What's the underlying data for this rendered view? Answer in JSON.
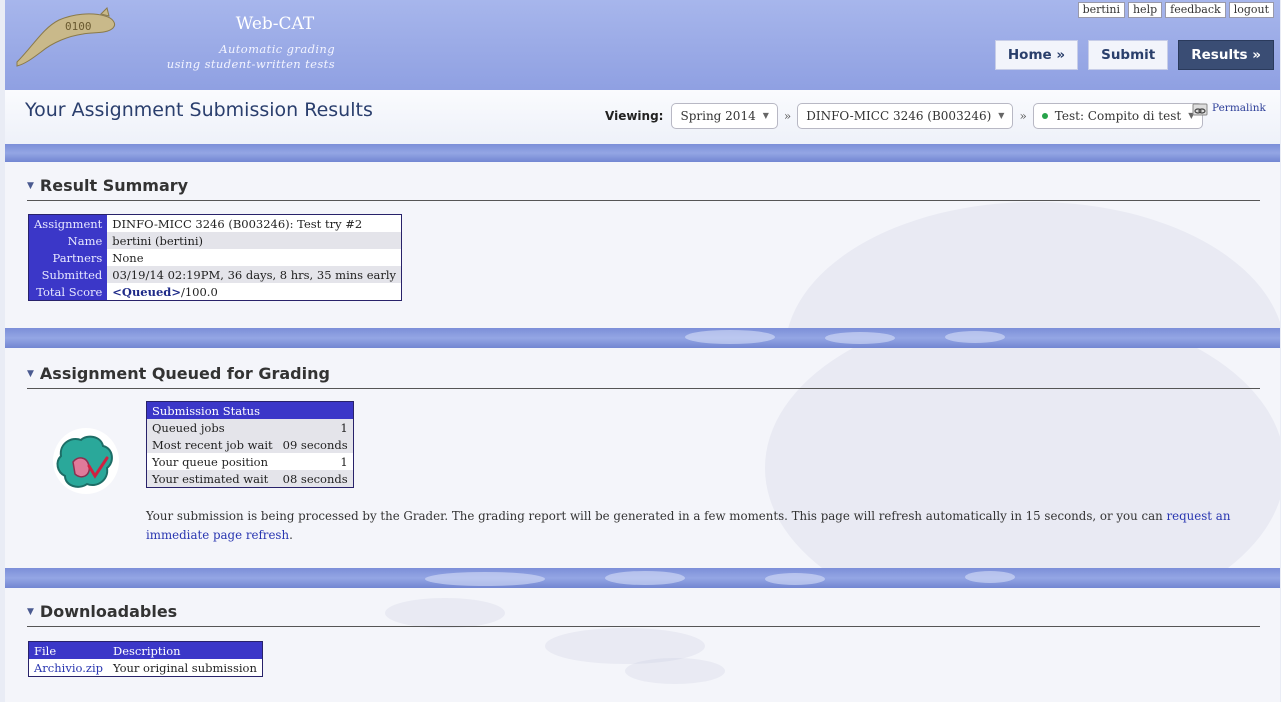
{
  "header": {
    "app_title": "Web-CAT",
    "tagline_1": "Automatic grading",
    "tagline_2": "using student-written tests",
    "logo_text": "0100",
    "toplinks": [
      "bertini",
      "help",
      "feedback",
      "logout"
    ],
    "nav": {
      "home": "Home »",
      "submit": "Submit",
      "results": "Results »"
    }
  },
  "titlebar": {
    "title": "Your Assignment Submission Results",
    "viewing_label": "Viewing:",
    "semester": "Spring 2014",
    "course": "DINFO-MICC 3246 (B003246)",
    "assignment": "Test: Compito di test",
    "separator": "»",
    "permalink": "Permalink"
  },
  "summary": {
    "heading": "Result Summary",
    "rows": [
      {
        "label": "Assignment",
        "value": "DINFO-MICC 3246 (B003246): Test try #2"
      },
      {
        "label": "Name",
        "value": "bertini (bertini)"
      },
      {
        "label": "Partners",
        "value": "None"
      },
      {
        "label": "Submitted",
        "value": "03/19/14 02:19PM, 36 days, 8 hrs, 35 mins early"
      },
      {
        "label": "Total Score",
        "value_bold": "<Queued>",
        "value_rest": "/100.0"
      }
    ]
  },
  "queue": {
    "heading": "Assignment Queued for Grading",
    "table_title": "Submission Status",
    "rows": [
      {
        "label": "Queued jobs",
        "value": "1"
      },
      {
        "label": "Most recent job wait",
        "value": "09 seconds"
      },
      {
        "label": "Your queue position",
        "value": "1"
      },
      {
        "label": "Your estimated wait",
        "value": "08 seconds"
      }
    ],
    "message": "Your submission is being processed by the Grader. The grading report will be generated in a few moments. This page will refresh automatically in 15 seconds, or you can",
    "refresh_link": "request an immediate page refresh",
    "message_end": "."
  },
  "downloads": {
    "heading": "Downloadables",
    "col_file": "File",
    "col_desc": "Description",
    "rows": [
      {
        "file": "Archivio.zip",
        "desc": "Your original submission"
      }
    ]
  },
  "colors": {
    "accent": "#3b37c8",
    "header": "#9aaae6",
    "dark_button": "#3a4d74"
  }
}
